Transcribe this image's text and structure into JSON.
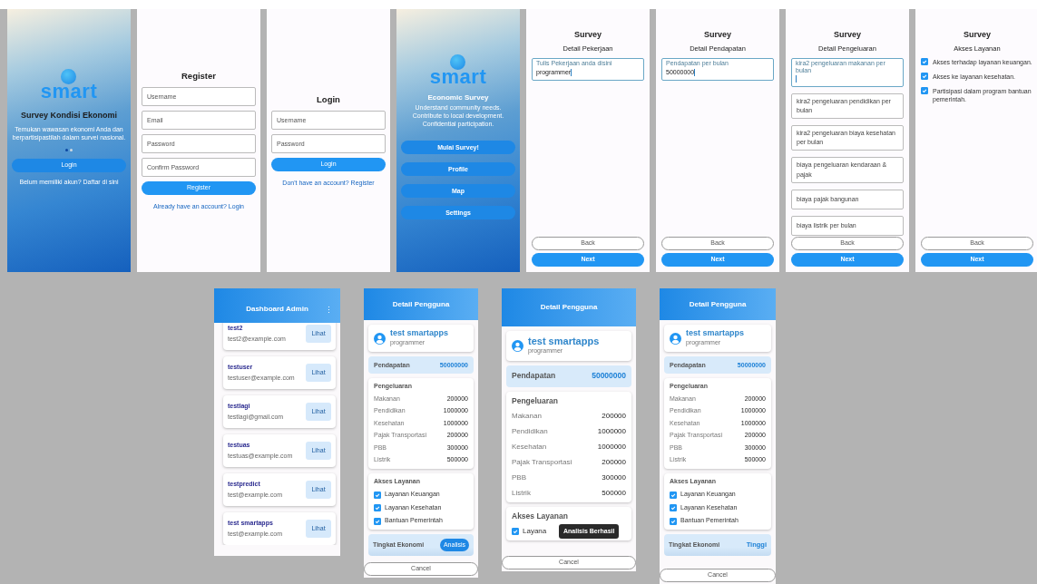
{
  "top_screens": [
    {
      "kind": "splash",
      "logo": "smart",
      "title": "Survey Kondisi Ekonomi",
      "subtitle": "Temukan wawasan ekonomi Anda dan berpartisipastilah dalam survei nasional.",
      "dots": [
        {
          "selected": true
        },
        {
          "selected": false
        }
      ],
      "button": "Login",
      "link": "Belum memiliki akun? Daftar di sini"
    },
    {
      "kind": "auth",
      "title": "Register",
      "fields": [
        {
          "placeholder": "Username"
        },
        {
          "placeholder": "Email"
        },
        {
          "placeholder": "Password"
        },
        {
          "placeholder": "Confirm Password"
        }
      ],
      "button": "Register",
      "link": "Already have an account? Login"
    },
    {
      "kind": "auth",
      "title": "Login",
      "fields": [
        {
          "placeholder": "Username"
        },
        {
          "placeholder": "Password"
        }
      ],
      "button": "Login",
      "link": "Don't have an account? Register"
    },
    {
      "kind": "home",
      "logo": "smart",
      "title": "Economic Survey",
      "lines": [
        "Understand community needs.",
        "Contribute to local development.",
        "Confidential participation."
      ],
      "buttons": [
        "Mulai Survey!",
        "Profile",
        "Map",
        "Settings"
      ]
    },
    {
      "kind": "survey",
      "title": "Survey",
      "subtitle": "Detail Pekerjaan",
      "items": [
        {
          "kind": "field",
          "label": "Tulis Pekerjaan anda disini",
          "value": "programmer",
          "focused": true
        }
      ],
      "back": "Back",
      "next": "Next"
    },
    {
      "kind": "survey",
      "title": "Survey",
      "subtitle": "Detail Pendapatan",
      "items": [
        {
          "kind": "field",
          "label": "Pendapatan per bulan",
          "value": "50000000",
          "focused": true
        }
      ],
      "back": "Back",
      "next": "Next"
    },
    {
      "kind": "survey",
      "title": "Survey",
      "subtitle": "Detail Pengeluaran",
      "items": [
        {
          "kind": "field",
          "label": "kira2 pengeluaran makanan per bulan",
          "focused": true
        },
        {
          "kind": "field",
          "placeholder": "kira2 pengeluaran pendidikan per bulan",
          "focused": false
        },
        {
          "kind": "field",
          "placeholder": "kira2 pengeluaran biaya kesehatan per bulan",
          "focused": false
        },
        {
          "kind": "field",
          "placeholder": "biaya pengeluaran kendaraan & pajak",
          "focused": false
        },
        {
          "kind": "field",
          "placeholder": "biaya pajak bangunan",
          "focused": false
        },
        {
          "kind": "field",
          "placeholder": "biaya listrik per bulan",
          "focused": false
        }
      ],
      "back": "Back",
      "next": "Next"
    },
    {
      "kind": "survey",
      "title": "Survey",
      "subtitle": "Akses Layanan",
      "items": [
        {
          "kind": "check",
          "label": "Akses terhadap layanan keuangan.",
          "checked": true
        },
        {
          "kind": "check",
          "label": "Akses ke layanan kesehatan.",
          "checked": true
        },
        {
          "kind": "check",
          "label": "Partisipasi dalam program bantuan pemerintah.",
          "checked": true
        }
      ],
      "back": "Back",
      "next": "Next"
    }
  ],
  "bottom_screens": [
    {
      "kind": "dashboard",
      "title": "Dashboard Admin",
      "menu": "⋮",
      "users": [
        {
          "name": "test2",
          "email": "test2@example.com",
          "action": "Lihat"
        },
        {
          "name": "testuser",
          "email": "testuser@example.com",
          "action": "Lihat"
        },
        {
          "name": "testlagi",
          "email": "testlagi@gmail.com",
          "action": "Lihat"
        },
        {
          "name": "testuas",
          "email": "testuas@example.com",
          "action": "Lihat"
        },
        {
          "name": "testpredict",
          "email": "test@example.com",
          "action": "Lihat"
        },
        {
          "name": "test smartapps",
          "email": "test@example.com",
          "action": "Lihat"
        }
      ]
    },
    {
      "kind": "detail",
      "title": "Detail Pengguna",
      "name": "test smartapps",
      "job": "programmer",
      "income_label": "Pendapatan",
      "income": "50000000",
      "expenses_title": "Pengeluaran",
      "expenses": [
        {
          "label": "Makanan",
          "value": "200000"
        },
        {
          "label": "Pendidikan",
          "value": "1000000"
        },
        {
          "label": "Kesehatan",
          "value": "1000000"
        },
        {
          "label": "Pajak Transportasi",
          "value": "200000"
        },
        {
          "label": "PBB",
          "value": "300000"
        },
        {
          "label": "Listrik",
          "value": "500000"
        }
      ],
      "access_title": "Akses Layanan",
      "access": [
        {
          "label": "Layanan Keuangan",
          "checked": true
        },
        {
          "label": "Layanan Kesehatan",
          "checked": true
        },
        {
          "label": "Bantuan Pemerintah",
          "checked": true
        }
      ],
      "level": {
        "label": "Tingkat Ekonomi",
        "action": "Analisis"
      },
      "cancel": "Cancel"
    },
    {
      "kind": "detail",
      "title": "Detail Pengguna",
      "name": "test smartapps",
      "job": "programmer",
      "income_label": "Pendapatan",
      "income": "50000000",
      "expenses_title": "Pengeluaran",
      "expenses": [
        {
          "label": "Makanan",
          "value": "200000"
        },
        {
          "label": "Pendidikan",
          "value": "1000000"
        },
        {
          "label": "Kesehatan",
          "value": "1000000"
        },
        {
          "label": "Pajak Transportasi",
          "value": "200000"
        },
        {
          "label": "PBB",
          "value": "300000"
        },
        {
          "label": "Listrik",
          "value": "500000"
        }
      ],
      "access_title": "Akses Layanan",
      "access": [
        {
          "label": "Layana",
          "checked": true
        }
      ],
      "toast": "Analisis Berhasil",
      "cancel": "Cancel"
    },
    {
      "kind": "detail",
      "title": "Detail Pengguna",
      "name": "test smartapps",
      "job": "programmer",
      "income_label": "Pendapatan",
      "income": "50000000",
      "expenses_title": "Pengeluaran",
      "expenses": [
        {
          "label": "Makanan",
          "value": "200000"
        },
        {
          "label": "Pendidikan",
          "value": "1000000"
        },
        {
          "label": "Kesehatan",
          "value": "1000000"
        },
        {
          "label": "Pajak Transportasi",
          "value": "200000"
        },
        {
          "label": "PBB",
          "value": "300000"
        },
        {
          "label": "Listrik",
          "value": "500000"
        }
      ],
      "access_title": "Akses Layanan",
      "access": [
        {
          "label": "Layanan Keuangan",
          "checked": true
        },
        {
          "label": "Layanan Kesehatan",
          "checked": true
        },
        {
          "label": "Bantuan Pemerintah",
          "checked": true
        }
      ],
      "level": {
        "label": "Tingkat Ekonomi",
        "value": "Tinggi"
      },
      "cancel": "Cancel"
    }
  ]
}
